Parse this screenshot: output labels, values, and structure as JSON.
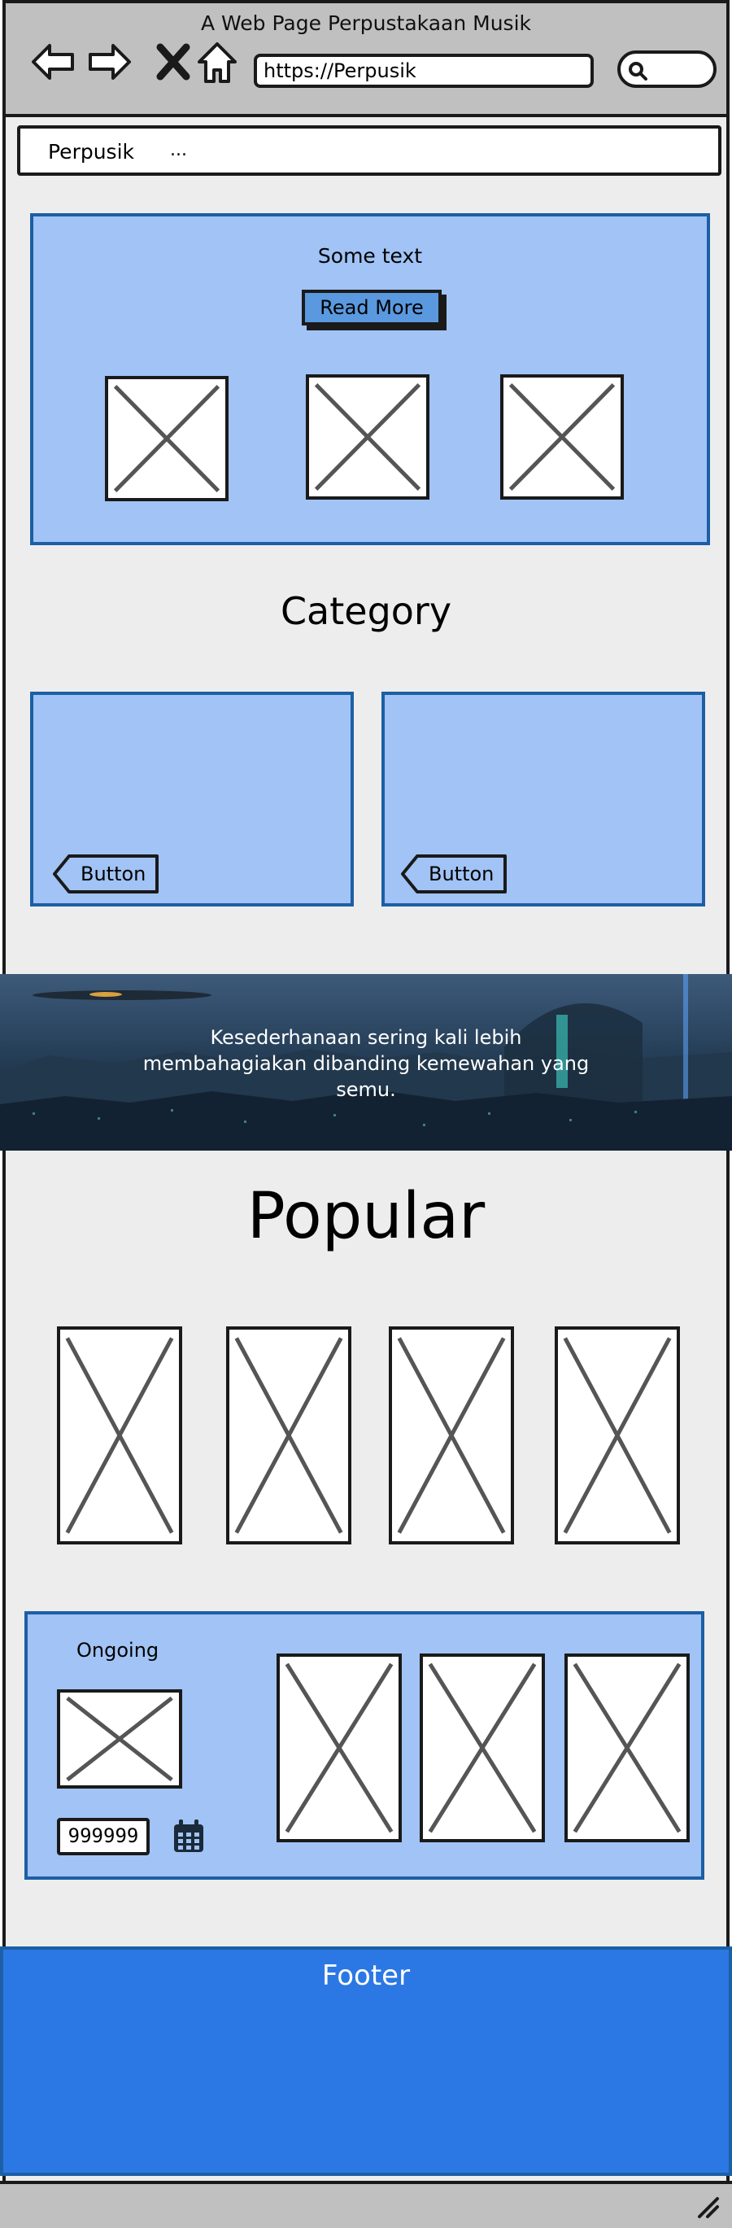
{
  "window": {
    "title": "A Web Page Perpustakaan Musik"
  },
  "browser": {
    "url": "https://Perpusik"
  },
  "nav": {
    "brand": "Perpusik",
    "more": "..."
  },
  "hero": {
    "text": "Some text",
    "button": "Read More"
  },
  "category": {
    "title": "Category",
    "cards": [
      {
        "button": "Button"
      },
      {
        "button": "Button"
      }
    ]
  },
  "banner": {
    "text": "Kesederhanaan sering kali lebih membahagiakan dibanding kemewahan yang semu."
  },
  "popular": {
    "title": "Popular"
  },
  "ongoing": {
    "label": "Ongoing",
    "counter": "999999"
  },
  "footer": {
    "text": "Footer"
  },
  "colors": {
    "panel": "#a1c3f5",
    "panel_border": "#1c5fa5",
    "footer": "#2b78e4",
    "chrome": "#c0c0c0"
  }
}
